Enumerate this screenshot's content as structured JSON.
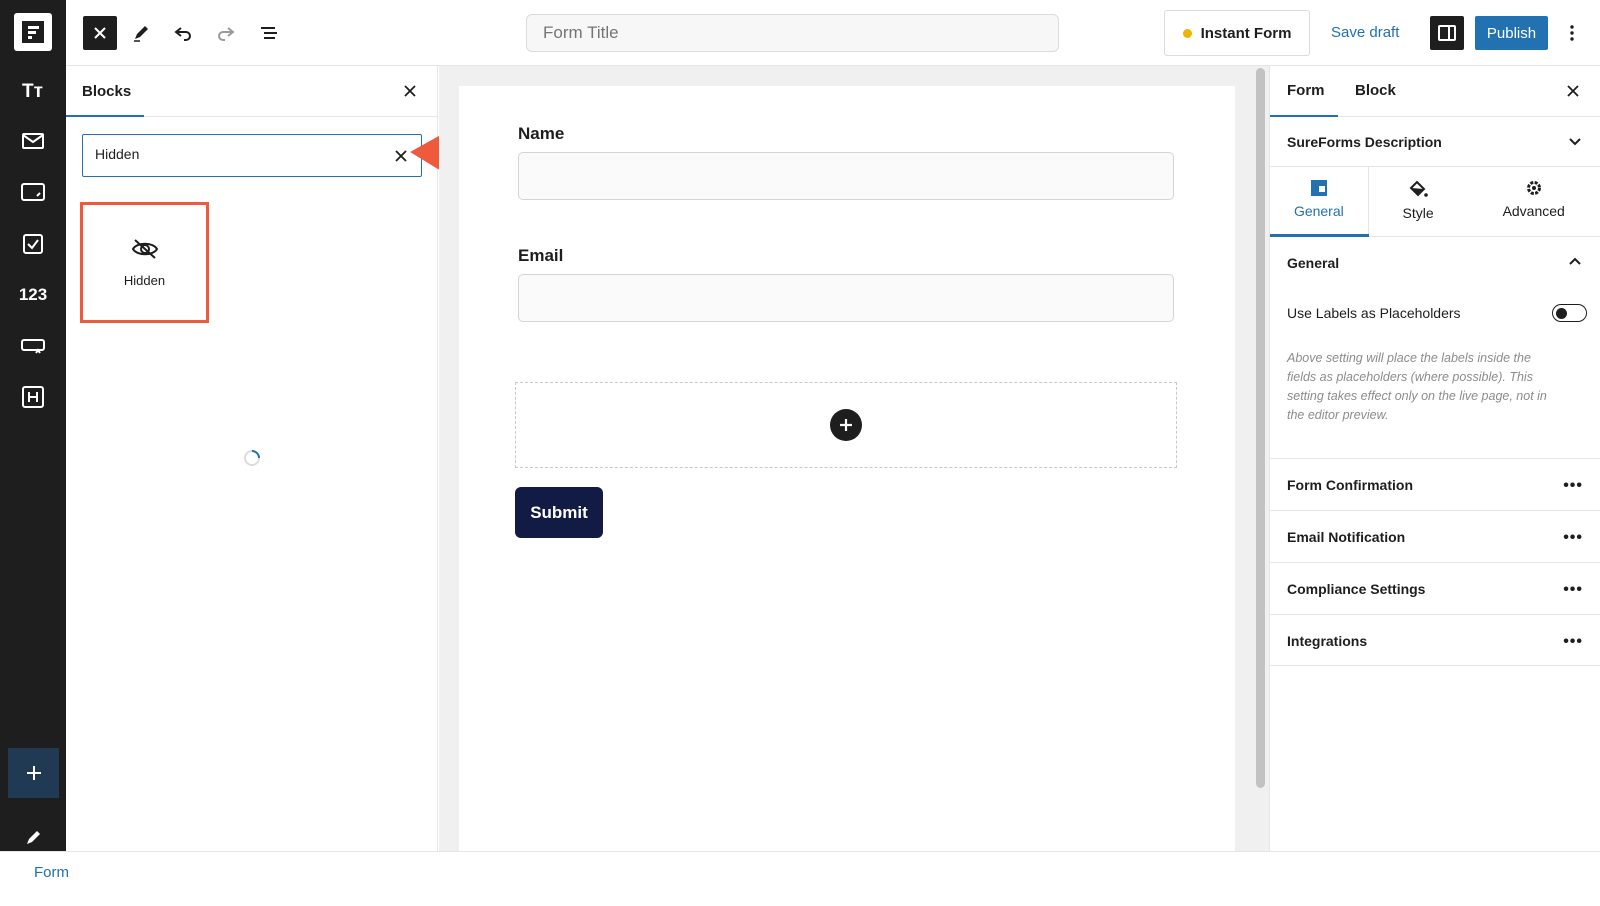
{
  "toolbar": {
    "form_title_placeholder": "Form Title",
    "instant_form_label": "Instant Form",
    "save_draft_label": "Save draft",
    "publish_label": "Publish",
    "accent_color": "#2271b1"
  },
  "rail": {
    "items": [
      "typography-icon",
      "envelope-icon",
      "input-icon",
      "checkbox-icon",
      "number-icon",
      "dropdown-icon",
      "heading-icon"
    ],
    "number_label": "123"
  },
  "blocks_panel": {
    "tab_label": "Blocks",
    "search_value": "Hidden",
    "result_label": "Hidden"
  },
  "canvas": {
    "name_label": "Name",
    "email_label": "Email",
    "submit_label": "Submit"
  },
  "sidebar": {
    "tabs": [
      "Form",
      "Block"
    ],
    "description_title": "SureForms Description",
    "sub_tabs": [
      "General",
      "Style",
      "Advanced"
    ],
    "general_title": "General",
    "toggle_label": "Use Labels as Placeholders",
    "help_text": "Above setting will place the labels inside the fields as placeholders (where possible). This setting takes effect only on the live page, not in the editor preview.",
    "sections": [
      "Form Confirmation",
      "Email Notification",
      "Compliance Settings",
      "Integrations"
    ]
  },
  "footer": {
    "breadcrumb": "Form"
  }
}
